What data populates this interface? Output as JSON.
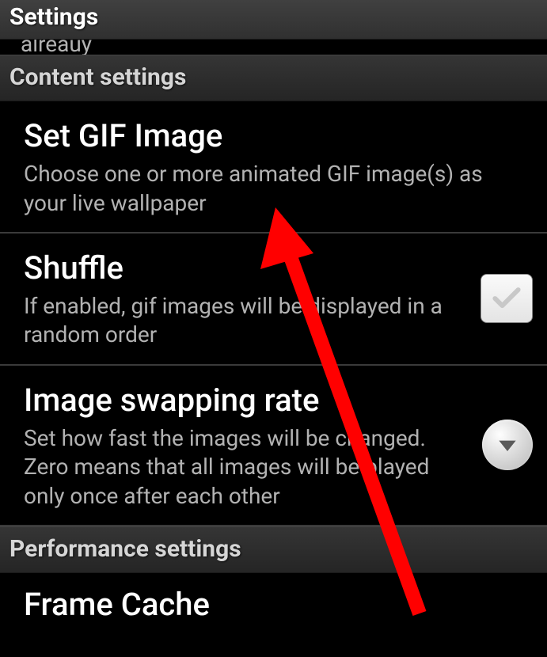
{
  "header": {
    "title": "Settings"
  },
  "partial_top_text": "alreauy",
  "sections": {
    "content": {
      "header": "Content settings",
      "items": {
        "set_gif": {
          "title": "Set GIF Image",
          "summary": "Choose one or more animated GIF image(s) as your live wallpaper"
        },
        "shuffle": {
          "title": "Shuffle",
          "summary": "If enabled, gif images will be displayed in a random order",
          "checked": false
        },
        "swap_rate": {
          "title": "Image swapping rate",
          "summary": "Set how fast the images will be changed. Zero means that all images will be played only once after each other"
        }
      }
    },
    "performance": {
      "header": "Performance settings",
      "items": {
        "frame_cache": {
          "title": "Frame Cache"
        }
      }
    }
  },
  "annotation": {
    "arrow_color": "#ff0000"
  }
}
